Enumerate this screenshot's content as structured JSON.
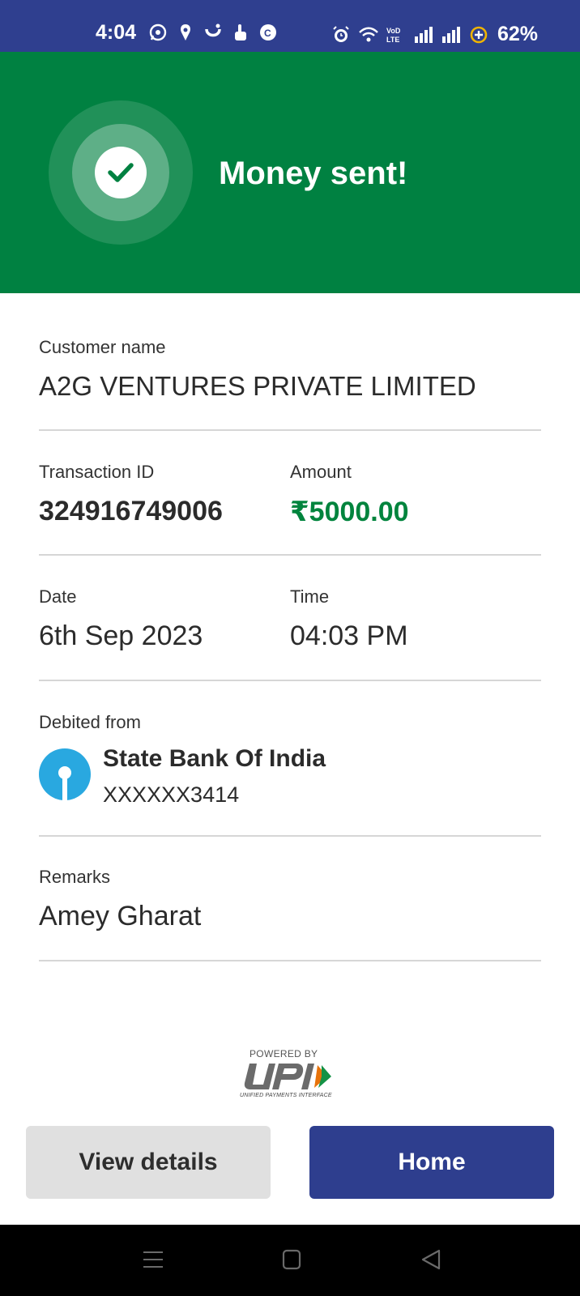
{
  "status_bar": {
    "time": "4:04",
    "battery": "62%",
    "app_icons": [
      "whatsapp-icon",
      "swiggy-icon",
      "app-icon",
      "hand-icon",
      "cred-icon"
    ],
    "system_icons": [
      "alarm-icon",
      "wifi-icon",
      "volte-icon",
      "signal-icon",
      "signal-icon",
      "battery-saver-icon"
    ]
  },
  "banner": {
    "title": "Money sent!",
    "color": "#008141"
  },
  "details": {
    "customer_label": "Customer name",
    "customer_value": "A2G VENTURES PRIVATE LIMITED",
    "txn_label": "Transaction ID",
    "txn_value": "324916749006",
    "amount_label": "Amount",
    "amount_value": "₹5000.00",
    "date_label": "Date",
    "date_value": "6th Sep 2023",
    "time_label": "Time",
    "time_value": "04:03 PM",
    "debited_label": "Debited from",
    "bank_name": "State Bank Of India",
    "bank_account": "XXXXXX3414",
    "remarks_label": "Remarks",
    "remarks_value": "Amey Gharat"
  },
  "upi": {
    "powered_by": "POWERED BY",
    "subtitle": "UNIFIED PAYMENTS INTERFACE"
  },
  "buttons": {
    "view_details": "View details",
    "home": "Home"
  },
  "colors": {
    "status_bar": "#2f3f8f",
    "success_green": "#008141",
    "primary_button": "#2e3e8e",
    "sbi_blue": "#29a8e0"
  }
}
